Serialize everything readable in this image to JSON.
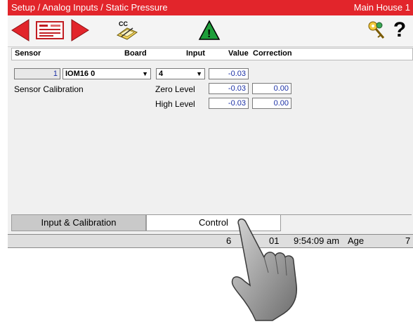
{
  "titlebar": {
    "breadcrumb": "Setup / Analog Inputs / Static Pressure",
    "location": "Main House 1"
  },
  "toolbar": {
    "buttons": [
      {
        "name": "previous-button",
        "icon": "red-left-arrow-icon"
      },
      {
        "name": "screen-list-button",
        "icon": "card-list-icon"
      },
      {
        "name": "next-button",
        "icon": "red-right-arrow-icon"
      },
      {
        "name": "copy-button",
        "icon": "cc-copy-icon",
        "label": "CC"
      },
      {
        "name": "alarm-button",
        "icon": "warning-triangle-icon",
        "label": "!"
      },
      {
        "name": "access-button",
        "icon": "key-icon"
      },
      {
        "name": "help-button",
        "icon": "question-icon",
        "label": "?"
      }
    ]
  },
  "table": {
    "headers": {
      "sensor": "Sensor",
      "board": "Board",
      "input": "Input",
      "value": "Value",
      "correction": "Correction"
    },
    "row": {
      "sensor_number": "1",
      "board": "IOM16 0",
      "input": "4",
      "value": "-0.03"
    }
  },
  "calibration": {
    "title": "Sensor Calibration",
    "zero_label": "Zero Level",
    "zero_value": "-0.03",
    "zero_correction": "0.00",
    "high_label": "High Level",
    "high_value": "-0.03",
    "high_correction": "0.00"
  },
  "tabs": [
    {
      "label": "Input & Calibration",
      "active": false
    },
    {
      "label": "Control",
      "active": true
    }
  ],
  "status": {
    "date": "6",
    "date_fragment": "01",
    "time": "9:54:09 am",
    "age_label": "Age",
    "age_value": "7"
  },
  "colors": {
    "title_bar": "#e2252b",
    "value_text": "#1a2fa5",
    "arrow_red": "#e2252b",
    "warning_green": "#1e9e3a"
  }
}
